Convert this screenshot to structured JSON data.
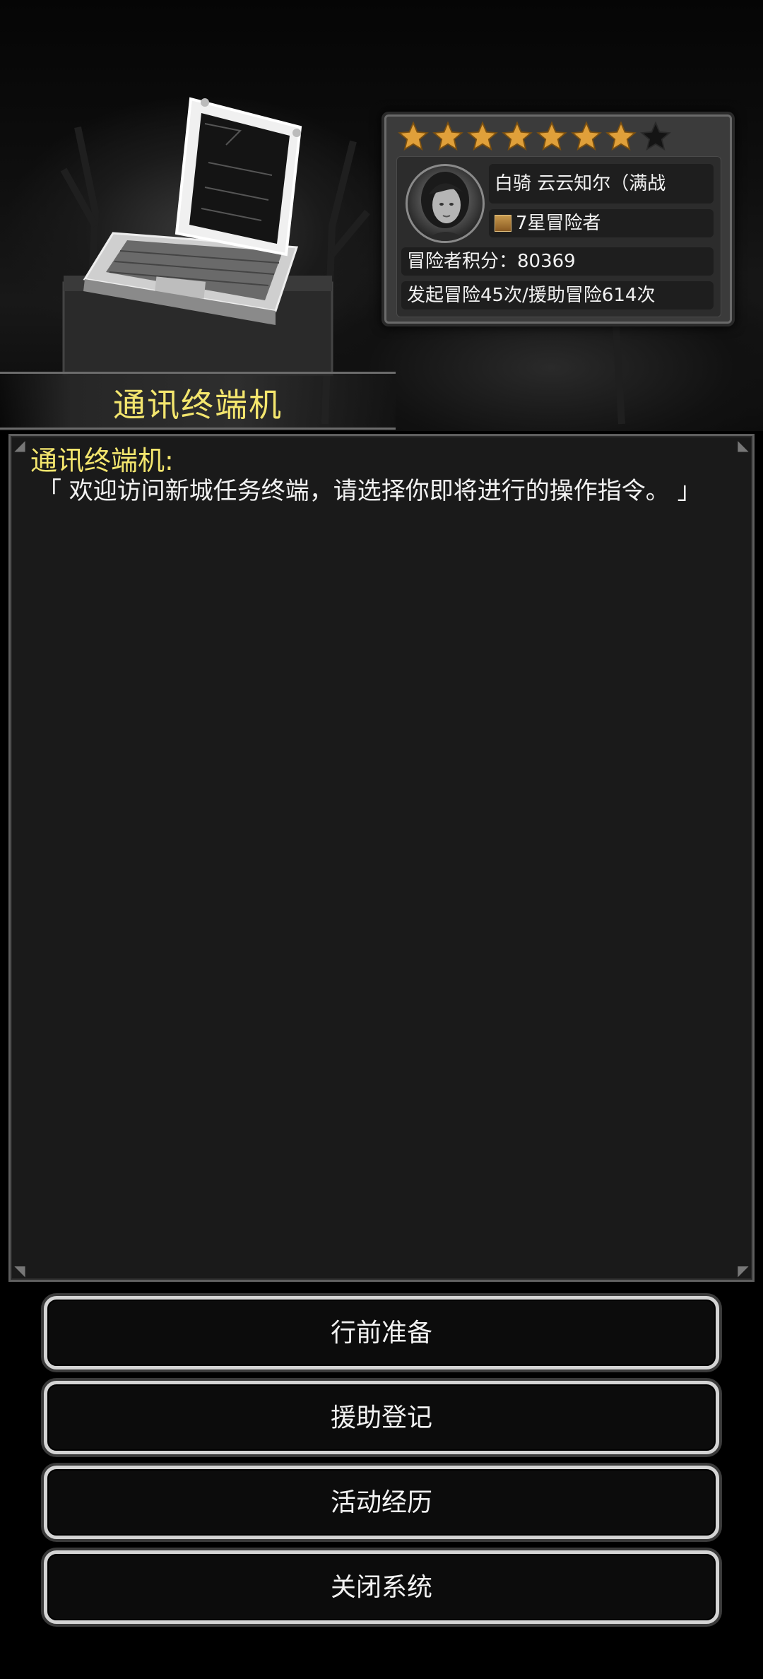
{
  "header": {
    "title": "通讯终端机"
  },
  "player_card": {
    "stars_filled": 7,
    "stars_total": 8,
    "name": "白骑 云云知尔（满战",
    "rank": "7星冒险者",
    "score": "冒险者积分：80369",
    "stats": "发起冒险45次/援助冒险614次"
  },
  "dialog": {
    "speaker": "通讯终端机:",
    "message": "「 欢迎访问新城任务终端，请选择你即将进行的操作指令。 」"
  },
  "menu": {
    "prepare": "行前准备",
    "assist_register": "援助登记",
    "activity_history": "活动经历",
    "close_system": "关闭系统"
  },
  "colors": {
    "title_yellow": "#f4e66e",
    "star_gold": "#e0a03a",
    "star_empty": "#141414"
  }
}
